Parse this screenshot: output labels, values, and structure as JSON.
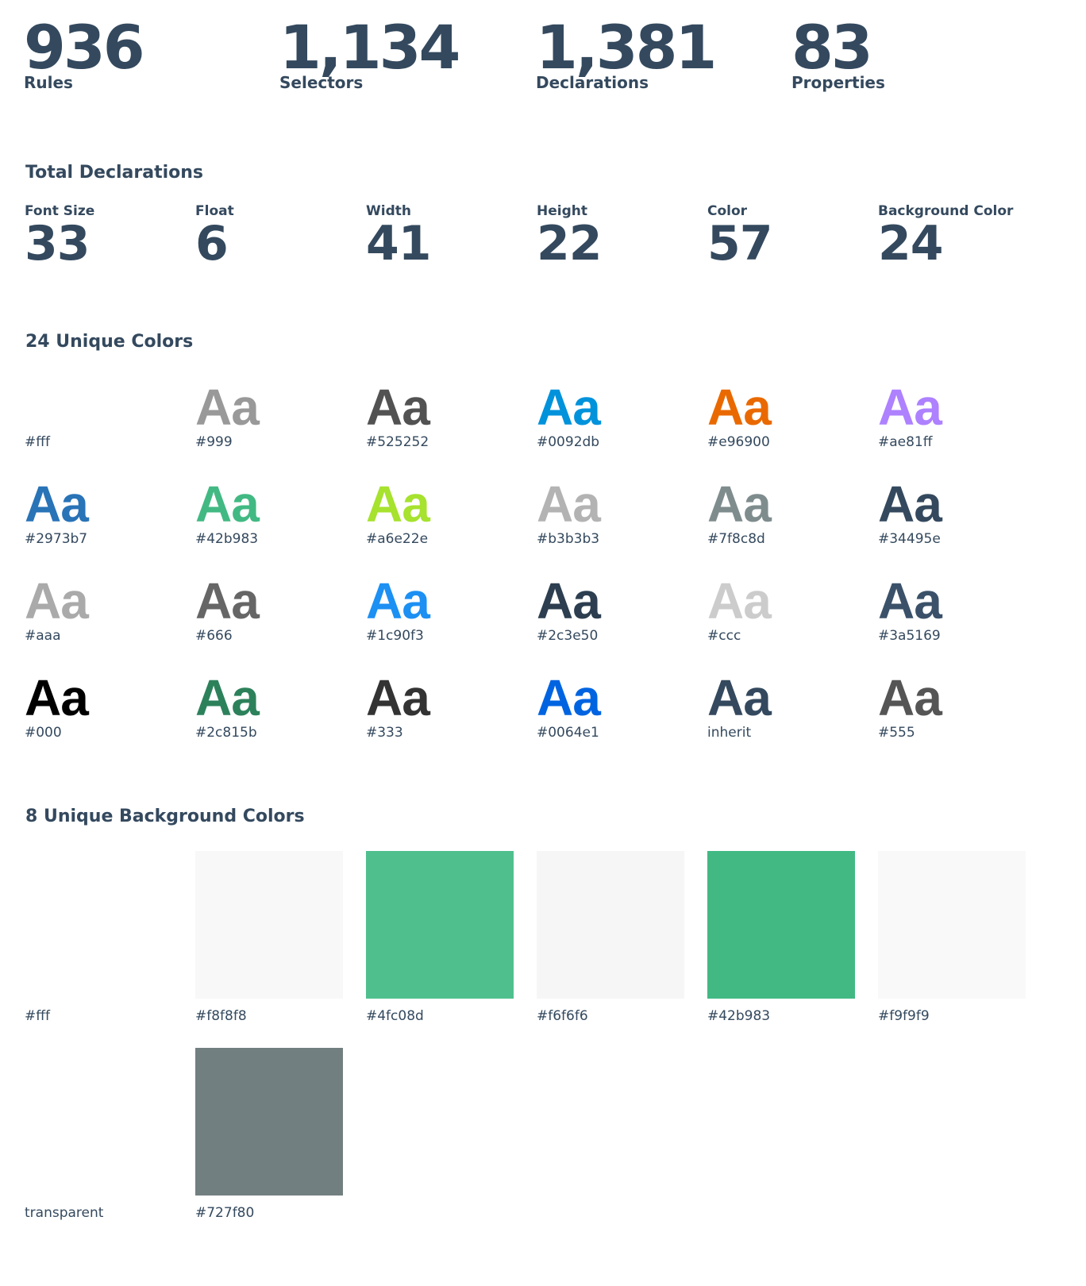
{
  "stats": [
    {
      "value": "936",
      "label": "Rules"
    },
    {
      "value": "1,134",
      "label": "Selectors"
    },
    {
      "value": "1,381",
      "label": "Declarations"
    },
    {
      "value": "83",
      "label": "Properties"
    }
  ],
  "total_declarations": {
    "heading": "Total Declarations",
    "items": [
      {
        "label": "Font Size",
        "value": "33"
      },
      {
        "label": "Float",
        "value": "6"
      },
      {
        "label": "Width",
        "value": "41"
      },
      {
        "label": "Height",
        "value": "22"
      },
      {
        "label": "Color",
        "value": "57"
      },
      {
        "label": "Background Color",
        "value": "24"
      }
    ]
  },
  "unique_colors": {
    "heading": "24 Unique Colors",
    "sample_text": "Aa",
    "items": [
      {
        "hex": "#fff",
        "color": "#ffffff"
      },
      {
        "hex": "#999",
        "color": "#999999"
      },
      {
        "hex": "#525252",
        "color": "#525252"
      },
      {
        "hex": "#0092db",
        "color": "#0092db"
      },
      {
        "hex": "#e96900",
        "color": "#e96900"
      },
      {
        "hex": "#ae81ff",
        "color": "#ae81ff"
      },
      {
        "hex": "#2973b7",
        "color": "#2973b7"
      },
      {
        "hex": "#42b983",
        "color": "#42b983"
      },
      {
        "hex": "#a6e22e",
        "color": "#a6e22e"
      },
      {
        "hex": "#b3b3b3",
        "color": "#b3b3b3"
      },
      {
        "hex": "#7f8c8d",
        "color": "#7f8c8d"
      },
      {
        "hex": "#34495e",
        "color": "#34495e"
      },
      {
        "hex": "#aaa",
        "color": "#aaaaaa"
      },
      {
        "hex": "#666",
        "color": "#666666"
      },
      {
        "hex": "#1c90f3",
        "color": "#1c90f3"
      },
      {
        "hex": "#2c3e50",
        "color": "#2c3e50"
      },
      {
        "hex": "#ccc",
        "color": "#cccccc"
      },
      {
        "hex": "#3a5169",
        "color": "#3a5169"
      },
      {
        "hex": "#000",
        "color": "#000000"
      },
      {
        "hex": "#2c815b",
        "color": "#2c815b"
      },
      {
        "hex": "#333",
        "color": "#333333"
      },
      {
        "hex": "#0064e1",
        "color": "#0064e1"
      },
      {
        "hex": "inherit",
        "color": "#34495e"
      },
      {
        "hex": "#555",
        "color": "#555555"
      }
    ]
  },
  "unique_background_colors": {
    "heading": "8 Unique Background Colors",
    "items": [
      {
        "hex": "#fff",
        "color": "#ffffff"
      },
      {
        "hex": "#f8f8f8",
        "color": "#f8f8f8"
      },
      {
        "hex": "#4fc08d",
        "color": "#4fc08d"
      },
      {
        "hex": "#f6f6f6",
        "color": "#f6f6f6"
      },
      {
        "hex": "#42b983",
        "color": "#42b983"
      },
      {
        "hex": "#f9f9f9",
        "color": "#f9f9f9"
      },
      {
        "hex": "transparent",
        "color": "transparent"
      },
      {
        "hex": "#727f80",
        "color": "#727f80"
      }
    ]
  }
}
